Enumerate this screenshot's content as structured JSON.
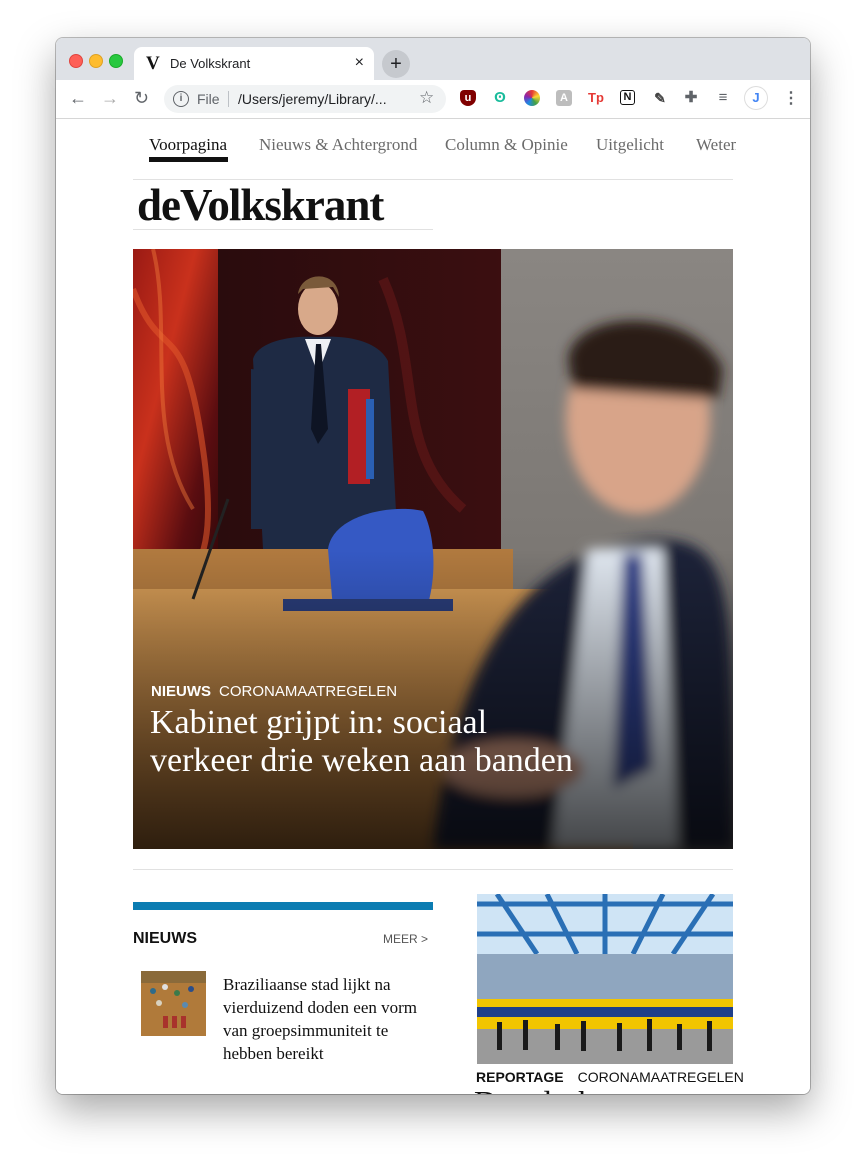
{
  "browser": {
    "tab_title": "De Volkskrant",
    "tab_favicon": "V",
    "tab_close": "×",
    "new_tab": "+",
    "omnibox": {
      "scheme_label": "File",
      "url": "/Users/jeremy/Library/..."
    },
    "extensions": [
      "ublock-origin-icon",
      "ghost-icon",
      "color-picker-icon",
      "a-icon",
      "typepad-icon",
      "notion-icon",
      "eyedropper-icon",
      "puzzle-extensions-icon",
      "reading-list-icon",
      "profile-avatar-icon"
    ]
  },
  "page": {
    "nav": [
      "Voorpagina",
      "Nieuws & Achtergrond",
      "Column & Opinie",
      "Uitgelicht",
      "Weten"
    ],
    "logo": "deVolkskrant",
    "hero": {
      "tag_primary": "NIEUWS",
      "tag_secondary": "CORONAMAATREGELEN",
      "headline": "Kabinet grijpt in: sociaal verkeer drie weken aan banden"
    },
    "section": {
      "title": "NIEUWS",
      "more": "MEER >",
      "story_1": "Braziliaanse stad lijkt na vierduizend doden een vorm van groepsimmuniteit te hebben bereikt"
    },
    "side": {
      "tag_primary": "REPORTAGE",
      "tag_secondary": "CORONAMAATREGELEN",
      "headline_partial": "Dag,drukte"
    }
  },
  "colors": {
    "accent": "#0b7cb2",
    "chrome": "#dee1e6"
  }
}
